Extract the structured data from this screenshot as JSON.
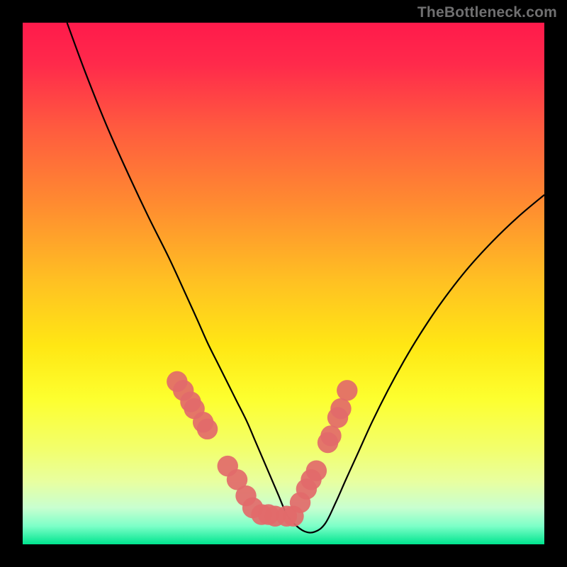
{
  "watermark": "TheBottleneck.com",
  "chart_data": {
    "type": "line",
    "title": "",
    "xlabel": "",
    "ylabel": "",
    "xlim": [
      0,
      100
    ],
    "ylim": [
      0,
      100
    ],
    "grid": false,
    "legend": false,
    "gradient_stops": [
      {
        "offset": 0.0,
        "color": "#ff1a4b"
      },
      {
        "offset": 0.08,
        "color": "#ff2a4b"
      },
      {
        "offset": 0.2,
        "color": "#ff5a3f"
      },
      {
        "offset": 0.35,
        "color": "#ff8c30"
      },
      {
        "offset": 0.5,
        "color": "#ffc222"
      },
      {
        "offset": 0.62,
        "color": "#ffe714"
      },
      {
        "offset": 0.72,
        "color": "#fdff2e"
      },
      {
        "offset": 0.82,
        "color": "#f2ff6e"
      },
      {
        "offset": 0.88,
        "color": "#e8ffa0"
      },
      {
        "offset": 0.93,
        "color": "#c8ffd0"
      },
      {
        "offset": 0.965,
        "color": "#7dffc8"
      },
      {
        "offset": 1.0,
        "color": "#00e58f"
      }
    ],
    "series": [
      {
        "name": "bottleneck-curve",
        "color": "#000000",
        "x": [
          8.5,
          12,
          16,
          20,
          24,
          28,
          31,
          33.5,
          35.5,
          37.5,
          39.5,
          41,
          43,
          44.5,
          46,
          47.5,
          49,
          50.5,
          52,
          54,
          56,
          58,
          60,
          62,
          64.5,
          67,
          70,
          73,
          76,
          80,
          85,
          90,
          95,
          100
        ],
        "y": [
          100,
          90.5,
          80.5,
          71.5,
          63,
          55,
          48.5,
          43,
          38.5,
          34.5,
          30.5,
          27.5,
          23.5,
          20,
          16.5,
          13,
          9.5,
          6,
          4,
          2.5,
          2.4,
          4,
          8,
          12.5,
          18,
          23.5,
          29.5,
          35,
          40,
          46,
          52.5,
          58,
          62.8,
          67
        ]
      }
    ],
    "markers": {
      "name": "sample-points",
      "color": "#e26a6a",
      "alpha": 0.92,
      "radius": 2.0,
      "x_pct": [
        29.6,
        30.8,
        32.2,
        32.9,
        34.6,
        35.4,
        39.3,
        41.1,
        42.8,
        44.1,
        45.8,
        47.1,
        48.4,
        50.6,
        51.9,
        53.2,
        54.4,
        55.3,
        56.3,
        58.5,
        59.1,
        60.4,
        61.0,
        62.2
      ],
      "y_pct": [
        68.8,
        70.5,
        72.7,
        74.0,
        76.6,
        77.9,
        85.0,
        87.6,
        90.7,
        93.0,
        94.3,
        94.3,
        94.6,
        94.6,
        94.6,
        92.0,
        89.4,
        87.6,
        85.9,
        80.5,
        79.2,
        75.7,
        74.0,
        70.5
      ]
    }
  }
}
